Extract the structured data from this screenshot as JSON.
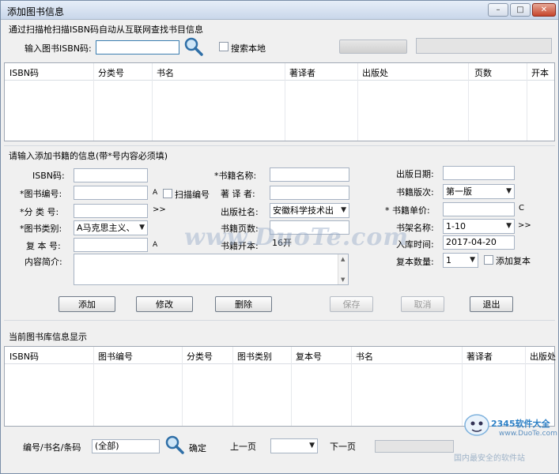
{
  "window": {
    "title": "添加图书信息",
    "minimize": "–",
    "maximize": "□",
    "close": "✕"
  },
  "isbn_search": {
    "group_label": "通过扫描枪扫描ISBN码自动从互联网查找书目信息",
    "isbn_label": "输入图书ISBN码:",
    "isbn_value": "",
    "search_local_label": "搜索本地"
  },
  "search_results": {
    "columns": [
      "ISBN码",
      "分类号",
      "书名",
      "著译者",
      "出版处",
      "页数",
      "开本"
    ]
  },
  "form": {
    "group_label": "请输入添加书籍的信息(带*号内容必须填)",
    "isbn_label": "ISBN码:",
    "isbn_value": "",
    "book_no_label": "*图书编号:",
    "book_no_value": "",
    "book_no_suffix": "A",
    "scan_no_label": "扫描编号",
    "class_no_label": "*分 类 号:",
    "class_no_value": "",
    "class_no_more": ">>",
    "category_label": "*图书类别:",
    "category_value": "A马克思主义、",
    "copy_no_label": "复 本 号:",
    "copy_no_value": "",
    "copy_no_suffix": "A",
    "summary_label": "内容简介:",
    "summary_value": "",
    "title_label": "*书籍名称:",
    "title_value": "",
    "author_label": "著 译 者:",
    "author_value": "",
    "publisher_label": "出版社名:",
    "publisher_value": "安徽科学技术出",
    "pages_label": "书籍页数:",
    "pages_value": "",
    "format_label": "书籍开本:",
    "format_value": "16开",
    "pub_date_label": "出版日期:",
    "pub_date_value": "",
    "edition_label": "书籍版次:",
    "edition_value": "第一版",
    "price_label": "* 书籍单价:",
    "price_value": "",
    "price_suffix": "C",
    "shelf_label": "书架名称:",
    "shelf_value": "1-10",
    "shelf_more": ">>",
    "stock_date_label": "入库时间:",
    "stock_date_value": "2017-04-20",
    "copies_label": "复本数量:",
    "copies_value": "1",
    "add_copies_label": "添加复本"
  },
  "buttons": {
    "add": "添加",
    "edit": "修改",
    "delete": "删除",
    "save": "保存",
    "cancel": "取消",
    "exit": "退出"
  },
  "library": {
    "group_label": "当前图书库信息显示",
    "columns": [
      "ISBN码",
      "图书编号",
      "分类号",
      "图书类别",
      "复本号",
      "书名",
      "著译者",
      "出版处"
    ]
  },
  "footer": {
    "filter_label": "编号/书名/条码",
    "filter_value": "(全部)",
    "confirm_label": "确定",
    "prev_label": "上一页",
    "page_value": "",
    "next_label": "下一页"
  },
  "overlay": {
    "watermark": "www.DuoTe.com",
    "logo_text": "2345软件大全",
    "logo_url": "www.DuoTe.com",
    "logo_slogan": "国内最安全的软件站"
  }
}
